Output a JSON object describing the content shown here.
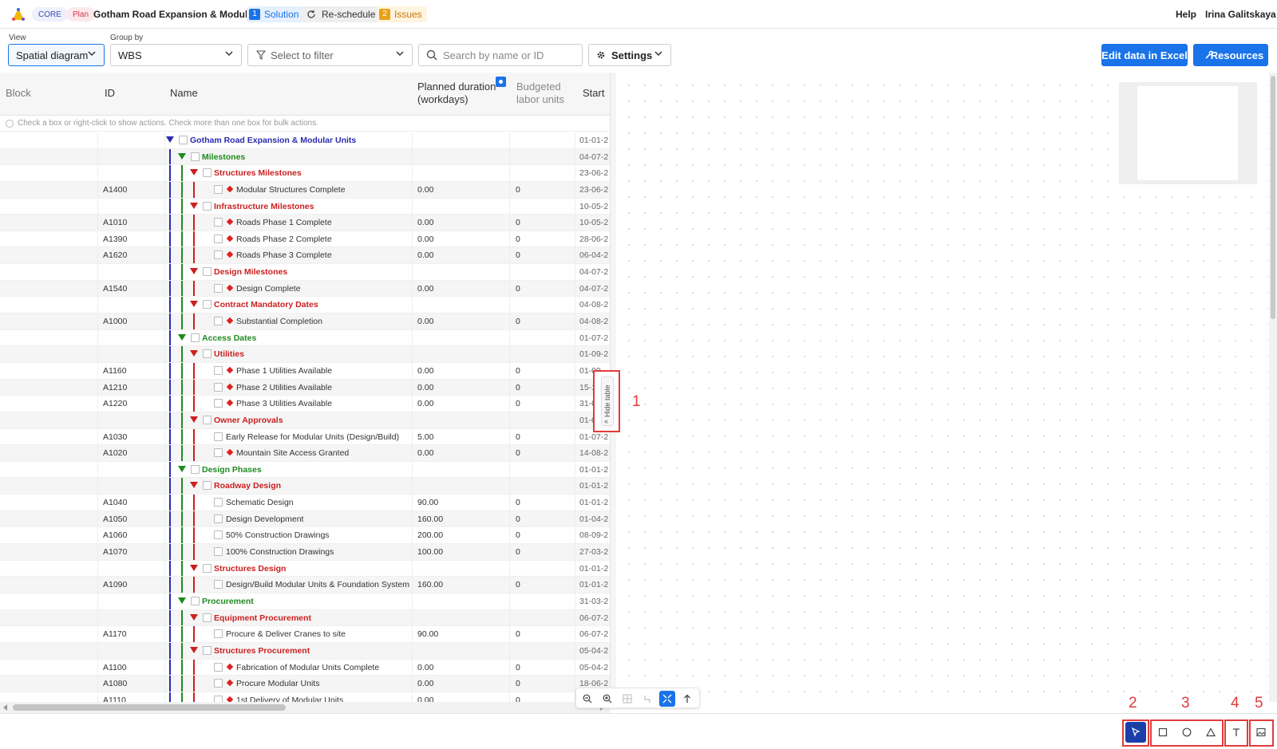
{
  "header": {
    "core_label": "CORE",
    "plan_label": "Plan",
    "project_title": "Gotham Road Expansion & Modular Units",
    "solution_count": "1",
    "solution_label": "Solution",
    "reschedule_label": "Re-schedule",
    "issues_count": "2",
    "issues_label": "Issues",
    "help_label": "Help",
    "user_name": "Irina Galitskaya"
  },
  "toolbar": {
    "view_label": "View",
    "view_value": "Spatial diagram",
    "group_label": "Group by",
    "group_value": "WBS",
    "filter_placeholder": "Select to filter",
    "search_placeholder": "Search by name or ID",
    "settings_label": "Settings",
    "excel_label": "Edit data in Excel",
    "resources_label": "Resources"
  },
  "table": {
    "columns": {
      "block": "Block",
      "id": "ID",
      "name": "Name",
      "duration_line1": "Planned duration",
      "duration_line2": "(workdays)",
      "labor_line1": "Budgeted",
      "labor_line2": "labor units",
      "start": "Start"
    },
    "info_text": "Check a box or right-click to show actions. Check more than one box for bulk actions.",
    "rows": [
      {
        "level": 0,
        "type": "group",
        "id": "",
        "name": "Gotham Road Expansion & Modular Units",
        "duration": "",
        "labor": "",
        "start": "01-01-2"
      },
      {
        "level": 1,
        "type": "group",
        "id": "",
        "name": "Milestones",
        "duration": "",
        "labor": "",
        "start": "04-07-2"
      },
      {
        "level": 2,
        "type": "group",
        "id": "",
        "name": "Structures Milestones",
        "duration": "",
        "labor": "",
        "start": "23-06-2"
      },
      {
        "level": 3,
        "type": "milestone",
        "id": "A1400",
        "name": "Modular Structures Complete",
        "duration": "0.00",
        "labor": "0",
        "start": "23-06-2"
      },
      {
        "level": 2,
        "type": "group",
        "id": "",
        "name": "Infrastructure Milestones",
        "duration": "",
        "labor": "",
        "start": "10-05-2"
      },
      {
        "level": 3,
        "type": "milestone",
        "id": "A1010",
        "name": "Roads Phase 1 Complete",
        "duration": "0.00",
        "labor": "0",
        "start": "10-05-2"
      },
      {
        "level": 3,
        "type": "milestone",
        "id": "A1390",
        "name": "Roads Phase 2 Complete",
        "duration": "0.00",
        "labor": "0",
        "start": "28-06-2"
      },
      {
        "level": 3,
        "type": "milestone",
        "id": "A1620",
        "name": "Roads Phase 3 Complete",
        "duration": "0.00",
        "labor": "0",
        "start": "06-04-2"
      },
      {
        "level": 2,
        "type": "group",
        "id": "",
        "name": "Design Milestones",
        "duration": "",
        "labor": "",
        "start": "04-07-2"
      },
      {
        "level": 3,
        "type": "milestone",
        "id": "A1540",
        "name": "Design Complete",
        "duration": "0.00",
        "labor": "0",
        "start": "04-07-2"
      },
      {
        "level": 2,
        "type": "group",
        "id": "",
        "name": "Contract Mandatory Dates",
        "duration": "",
        "labor": "",
        "start": "04-08-2"
      },
      {
        "level": 3,
        "type": "milestone",
        "id": "A1000",
        "name": "Substantial Completion",
        "duration": "0.00",
        "labor": "0",
        "start": "04-08-2"
      },
      {
        "level": 1,
        "type": "group",
        "id": "",
        "name": "Access Dates",
        "duration": "",
        "labor": "",
        "start": "01-07-2"
      },
      {
        "level": 2,
        "type": "group",
        "id": "",
        "name": "Utilities",
        "duration": "",
        "labor": "",
        "start": "01-09-2"
      },
      {
        "level": 3,
        "type": "milestone",
        "id": "A1160",
        "name": "Phase 1 Utilities Available",
        "duration": "0.00",
        "labor": "0",
        "start": "01-09-"
      },
      {
        "level": 3,
        "type": "milestone",
        "id": "A1210",
        "name": "Phase 2 Utilities Available",
        "duration": "0.00",
        "labor": "0",
        "start": "15-1"
      },
      {
        "level": 3,
        "type": "milestone",
        "id": "A1220",
        "name": "Phase 3 Utilities Available",
        "duration": "0.00",
        "labor": "0",
        "start": "31-0"
      },
      {
        "level": 2,
        "type": "group",
        "id": "",
        "name": "Owner Approvals",
        "duration": "",
        "labor": "",
        "start": "01-0"
      },
      {
        "level": 3,
        "type": "task",
        "id": "A1030",
        "name": "Early Release for Modular Units (Design/Build)",
        "duration": "5.00",
        "labor": "0",
        "start": "01-07-2"
      },
      {
        "level": 3,
        "type": "milestone",
        "id": "A1020",
        "name": "Mountain Site Access Granted",
        "duration": "0.00",
        "labor": "0",
        "start": "14-08-2"
      },
      {
        "level": 1,
        "type": "group",
        "id": "",
        "name": "Design Phases",
        "duration": "",
        "labor": "",
        "start": "01-01-2"
      },
      {
        "level": 2,
        "type": "group",
        "id": "",
        "name": "Roadway Design",
        "duration": "",
        "labor": "",
        "start": "01-01-2"
      },
      {
        "level": 3,
        "type": "task",
        "id": "A1040",
        "name": "Schematic Design",
        "duration": "90.00",
        "labor": "0",
        "start": "01-01-2"
      },
      {
        "level": 3,
        "type": "task",
        "id": "A1050",
        "name": "Design Development",
        "duration": "160.00",
        "labor": "0",
        "start": "01-04-2"
      },
      {
        "level": 3,
        "type": "task",
        "id": "A1060",
        "name": "50% Construction Drawings",
        "duration": "200.00",
        "labor": "0",
        "start": "08-09-2"
      },
      {
        "level": 3,
        "type": "task",
        "id": "A1070",
        "name": "100% Construction Drawings",
        "duration": "100.00",
        "labor": "0",
        "start": "27-03-2"
      },
      {
        "level": 2,
        "type": "group",
        "id": "",
        "name": "Structures Design",
        "duration": "",
        "labor": "",
        "start": "01-01-2"
      },
      {
        "level": 3,
        "type": "task",
        "id": "A1090",
        "name": "Design/Build Modular Units & Foundation System",
        "duration": "160.00",
        "labor": "0",
        "start": "01-01-2"
      },
      {
        "level": 1,
        "type": "group",
        "id": "",
        "name": "Procurement",
        "duration": "",
        "labor": "",
        "start": "31-03-2"
      },
      {
        "level": 2,
        "type": "group",
        "id": "",
        "name": "Equipment Procurement",
        "duration": "",
        "labor": "",
        "start": "06-07-2"
      },
      {
        "level": 3,
        "type": "task",
        "id": "A1170",
        "name": "Procure & Deliver Cranes to site",
        "duration": "90.00",
        "labor": "0",
        "start": "06-07-2"
      },
      {
        "level": 2,
        "type": "group",
        "id": "",
        "name": "Structures Procurement",
        "duration": "",
        "labor": "",
        "start": "05-04-2"
      },
      {
        "level": 3,
        "type": "milestone",
        "id": "A1100",
        "name": "Fabrication of Modular Units Complete",
        "duration": "0.00",
        "labor": "0",
        "start": "05-04-2"
      },
      {
        "level": 3,
        "type": "milestone",
        "id": "A1080",
        "name": "Procure Modular Units",
        "duration": "0.00",
        "labor": "0",
        "start": "18-06-2"
      },
      {
        "level": 3,
        "type": "milestone",
        "id": "A1110",
        "name": "1st Delivery of Modular Units",
        "duration": "0.00",
        "labor": "0",
        "start": ""
      }
    ]
  },
  "hide_table_label": "Hide table",
  "annotations": [
    "1",
    "2",
    "3",
    "4",
    "5"
  ],
  "colors": {
    "accent": "#1a73e8",
    "level0": "#2a2ab0",
    "level1": "#1f8a1f",
    "level2": "#cc1f1f",
    "marker": "#e23b3b"
  },
  "icons": [
    "logo-icon",
    "refresh-icon",
    "chevron-down-icon",
    "filter-icon",
    "search-icon",
    "gear-icon",
    "wrench-icon",
    "zoom-out-icon",
    "zoom-in-icon",
    "grid-icon",
    "undo-icon",
    "fit-icon",
    "arrow-up-icon",
    "pointer-icon",
    "rectangle-icon",
    "circle-icon",
    "triangle-icon",
    "text-icon",
    "image-icon"
  ]
}
